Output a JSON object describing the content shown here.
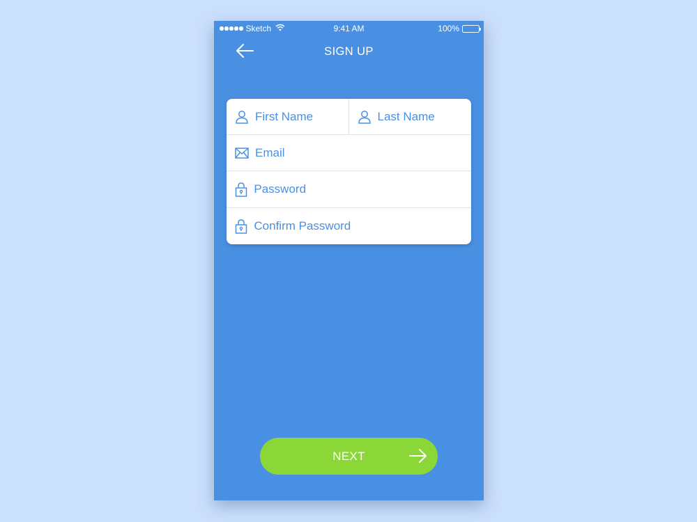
{
  "status_bar": {
    "carrier": "Sketch",
    "time": "9:41 AM",
    "battery": "100%",
    "icons": [
      "signal-dots-icon",
      "wifi-icon",
      "battery-icon"
    ]
  },
  "nav": {
    "title": "SIGN UP",
    "back_icon": "arrow-left-icon"
  },
  "form": {
    "first_name": {
      "placeholder": "First Name",
      "value": "",
      "icon": "user-icon"
    },
    "last_name": {
      "placeholder": "Last Name",
      "value": "",
      "icon": "user-icon"
    },
    "email": {
      "placeholder": "Email",
      "value": "",
      "icon": "envelope-icon"
    },
    "password": {
      "placeholder": "Password",
      "value": "",
      "icon": "lock-icon"
    },
    "confirm_password": {
      "placeholder": "Confirm Password",
      "value": "",
      "icon": "lock-icon"
    }
  },
  "next_button": {
    "label": "NEXT",
    "icon": "arrow-right-icon"
  },
  "colors": {
    "background": "#cbe0fd",
    "phone_background": "#4a90e2",
    "accent_text": "#4a90e2",
    "card": "#ffffff",
    "next_button": "#8bd738"
  }
}
